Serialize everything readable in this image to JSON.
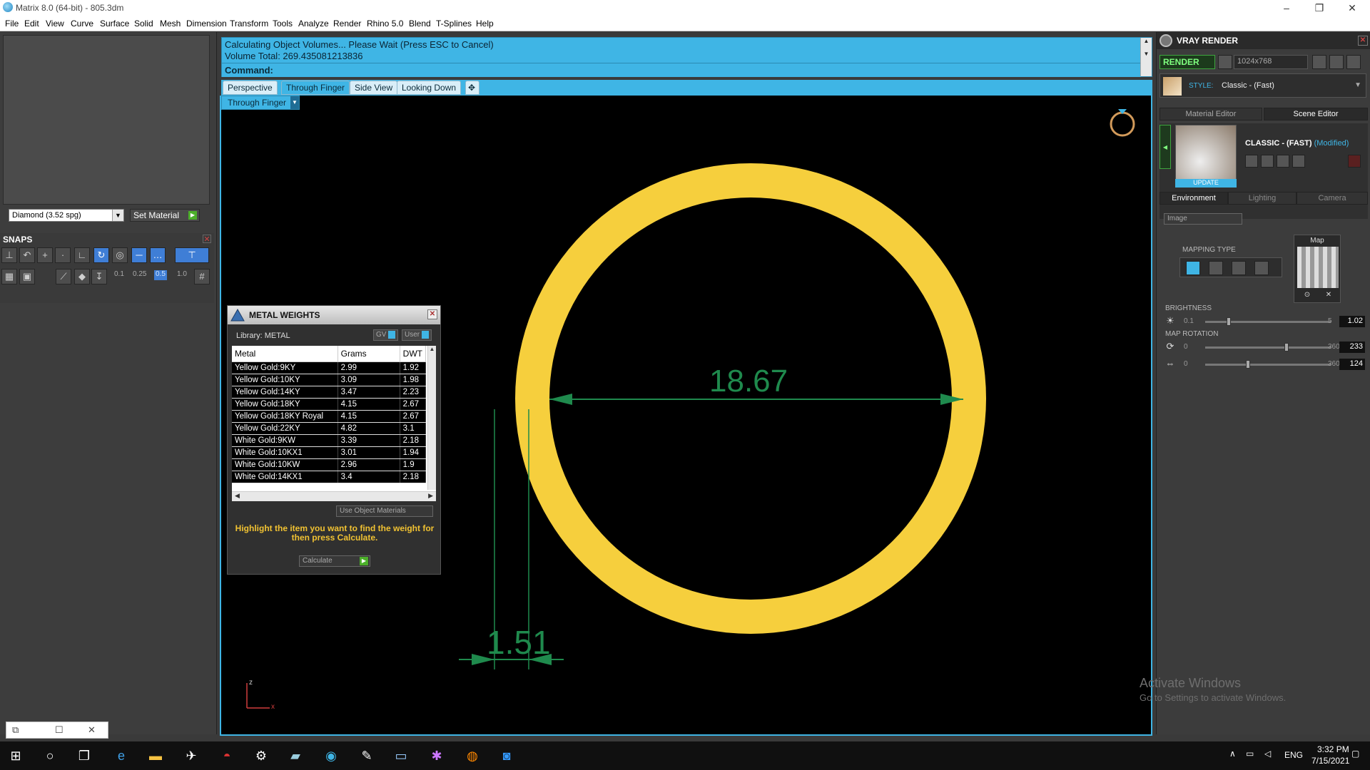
{
  "window": {
    "title": "Matrix 8.0 (64-bit) - 805.3dm",
    "minimize": "–",
    "maximize": "❐",
    "close": "✕"
  },
  "menu": [
    "File",
    "Edit",
    "View",
    "Curve",
    "Surface",
    "Solid",
    "Mesh",
    "Dimension",
    "Transform",
    "Tools",
    "Analyze",
    "Render",
    "Rhino 5.0",
    "Blend",
    "T-Splines",
    "Help"
  ],
  "left": {
    "material_select": "Diamond   (3.52 spg)",
    "set_material": "Set Material",
    "snaps_title": "SNAPS",
    "snap_values": [
      "0.1",
      "0.25",
      "0.5",
      "1.0"
    ]
  },
  "command": {
    "line1": "Calculating Object Volumes... Please Wait (Press ESC to Cancel)",
    "line2": "Volume Total: 269.435081213836",
    "prompt": "Command:"
  },
  "viewport": {
    "tabs": [
      "Perspective",
      "Through Finger",
      "Side View",
      "Looking Down"
    ],
    "active_tab": "Through Finger",
    "view_dropdown": "Through Finger",
    "dim_diameter": "18.67",
    "dim_thickness": "1.51",
    "axis_label": "z",
    "axis_label_x": "x",
    "ring_color": "#f6cf3d",
    "dim_color": "#1f8a4d"
  },
  "metal_weights": {
    "title": "METAL WEIGHTS",
    "library": "Library: METAL",
    "toggle_gv": "GV",
    "toggle_user": "User",
    "columns": [
      "Metal",
      "Grams",
      "DWT"
    ],
    "rows": [
      [
        "Yellow Gold:9KY",
        "2.99",
        "1.92"
      ],
      [
        "Yellow Gold:10KY",
        "3.09",
        "1.98"
      ],
      [
        "Yellow Gold:14KY",
        "3.47",
        "2.23"
      ],
      [
        "Yellow Gold:18KY",
        "4.15",
        "2.67"
      ],
      [
        "Yellow Gold:18KY Royal",
        "4.15",
        "2.67"
      ],
      [
        "Yellow Gold:22KY",
        "4.82",
        "3.1"
      ],
      [
        "White Gold:9KW",
        "3.39",
        "2.18"
      ],
      [
        "White Gold:10KX1",
        "3.01",
        "1.94"
      ],
      [
        "White Gold:10KW",
        "2.96",
        "1.9"
      ],
      [
        "White Gold:14KX1",
        "3.4",
        "2.18"
      ]
    ],
    "use_object_materials": "Use Object Materials",
    "hint": "Highlight the item you want to find the weight for then press Calculate.",
    "calculate": "Calculate"
  },
  "vray": {
    "title": "VRAY RENDER",
    "render": "RENDER",
    "resolution": "1024x768",
    "style_label": "STYLE:",
    "style_value": "Classic - (Fast)",
    "tabs": [
      "Material Editor",
      "Scene Editor"
    ],
    "active_tab": "Scene Editor",
    "scene_name": "CLASSIC - (FAST)",
    "scene_modified": "(Modified)",
    "update": "UPDATE",
    "subtabs": [
      "Environment",
      "Lighting",
      "Camera"
    ],
    "active_subtab": "Environment",
    "env_type": "Image",
    "mapping_type": "MAPPING TYPE",
    "map_label": "Map",
    "brightness_label": "BRIGHTNESS",
    "brightness": {
      "min": "0.1",
      "max": "5",
      "value": "1.02",
      "level": 0.19
    },
    "map_rotation_label": "MAP ROTATION",
    "rotation1": {
      "min": "0",
      "max": "360",
      "value": "233",
      "level": 0.65
    },
    "rotation2": {
      "min": "0",
      "max": "360",
      "value": "124",
      "level": 0.34
    }
  },
  "watermark": {
    "line1": "Activate Windows",
    "line2": "Go to Settings to activate Windows."
  },
  "taskbar": {
    "lang": "ENG",
    "time": "3:32 PM",
    "date": "7/15/2021"
  }
}
